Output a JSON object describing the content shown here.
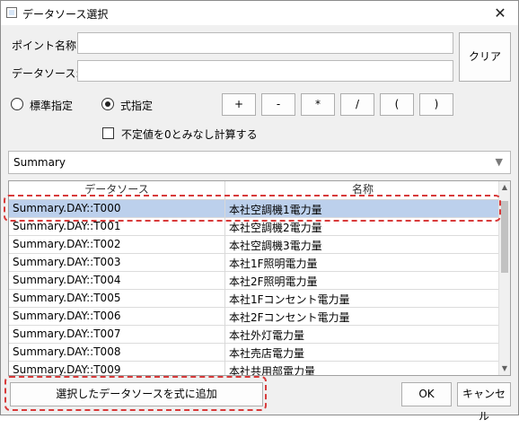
{
  "window": {
    "title": "データソース選択",
    "close_glyph": "✕"
  },
  "form": {
    "point_name_label": "ポイント名称:",
    "point_name_value": "",
    "data_source_label": "データソース:",
    "data_source_value": "",
    "clear_button": "クリア"
  },
  "mode": {
    "standard_label": "標準指定",
    "standard_selected": false,
    "formula_label": "式指定",
    "formula_selected": true
  },
  "operators": [
    "+",
    "-",
    "*",
    "/",
    "(",
    ")"
  ],
  "undefined_as_zero": {
    "label": "不定値を0とみなし計算する",
    "checked": false
  },
  "source_combo": {
    "value": "Summary",
    "arrow_glyph": "▼"
  },
  "table": {
    "columns": [
      "データソース",
      "名称"
    ],
    "rows": [
      [
        "Summary.DAY::T000",
        "本社空調機1電力量"
      ],
      [
        "Summary.DAY::T001",
        "本社空調機2電力量"
      ],
      [
        "Summary.DAY::T002",
        "本社空調機3電力量"
      ],
      [
        "Summary.DAY::T003",
        "本社1F照明電力量"
      ],
      [
        "Summary.DAY::T004",
        "本社2F照明電力量"
      ],
      [
        "Summary.DAY::T005",
        "本社1Fコンセント電力量"
      ],
      [
        "Summary.DAY::T006",
        "本社2Fコンセント電力量"
      ],
      [
        "Summary.DAY::T007",
        "本社外灯電力量"
      ],
      [
        "Summary.DAY::T008",
        "本社売店電力量"
      ],
      [
        "Summary.DAY::T009",
        "本社共用部電力量"
      ]
    ],
    "selected_row": 0
  },
  "footer": {
    "add_button": "選択したデータソースを式に追加",
    "ok_button": "OK",
    "cancel_button": "キャンセル"
  },
  "colors": {
    "selection": "#bcd0ec",
    "highlight": "#d83a3a"
  }
}
